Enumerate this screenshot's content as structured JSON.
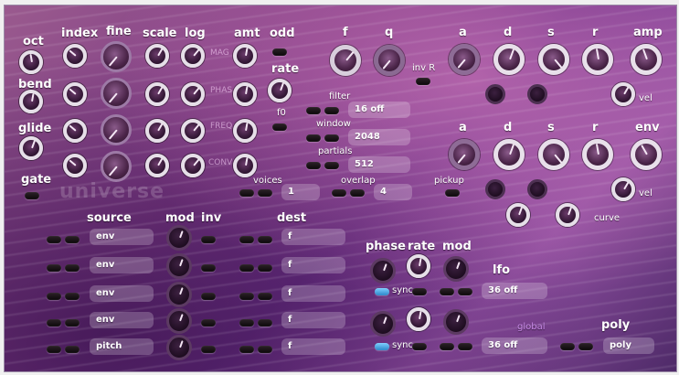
{
  "watermark": "universe",
  "labels": {
    "oct": "oct",
    "index": "index",
    "fine": "fine",
    "scale": "scale",
    "log": "log",
    "amt": "amt",
    "odd": "odd",
    "rate": "rate",
    "f0": "f0",
    "bend": "bend",
    "glide": "glide",
    "gate": "gate",
    "mag": "MAG",
    "phas": "PHAS",
    "freq": "FREQ",
    "conv": "CONV",
    "f": "f",
    "q": "q",
    "invr": "inv R",
    "filter": "filter",
    "window": "window",
    "partials": "partials",
    "a1": "a",
    "d1": "d",
    "s1": "s",
    "r1": "r",
    "amp": "amp",
    "vel1": "vel",
    "a2": "a",
    "d2": "d",
    "s2": "s",
    "r2": "r",
    "env": "env",
    "vel2": "vel",
    "voices": "voices",
    "overlap": "overlap",
    "pickup": "pickup",
    "curve": "curve",
    "source": "source",
    "mod": "mod",
    "inv": "inv",
    "dest": "dest",
    "phase": "phase",
    "rate2": "rate",
    "mod2": "mod",
    "lfo": "lfo",
    "sync1": "sync",
    "sync2": "sync",
    "global": "global",
    "poly": "poly"
  },
  "fields": {
    "filter": "16 off",
    "window": "2048",
    "partials": "512",
    "voices": "1",
    "overlap": "4",
    "lfo1": "36 off",
    "lfo2": "36 off",
    "poly": "poly"
  },
  "mod_rows": [
    {
      "source": "env",
      "dest": "f"
    },
    {
      "source": "env",
      "dest": "f"
    },
    {
      "source": "env",
      "dest": "f"
    },
    {
      "source": "env",
      "dest": "f"
    },
    {
      "source": "pitch",
      "dest": "f"
    }
  ]
}
